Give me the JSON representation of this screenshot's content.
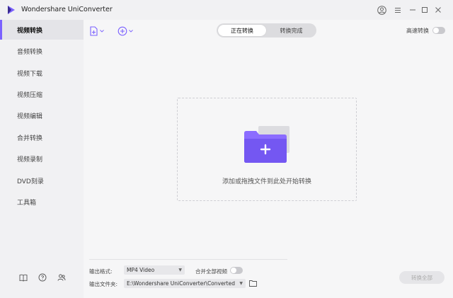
{
  "app": {
    "title": "Wondershare UniConverter",
    "accent_color": "#7b61ff"
  },
  "window_controls": [
    "account-icon",
    "menu-icon",
    "minimize-icon",
    "maximize-icon",
    "close-icon"
  ],
  "sidebar": {
    "items": [
      {
        "label": "视频转换",
        "active": true
      },
      {
        "label": "音频转换",
        "active": false
      },
      {
        "label": "视频下载",
        "active": false
      },
      {
        "label": "视频压缩",
        "active": false
      },
      {
        "label": "视频编辑",
        "active": false
      },
      {
        "label": "合并转换",
        "active": false
      },
      {
        "label": "视频录制",
        "active": false
      },
      {
        "label": "DVD刻录",
        "active": false
      },
      {
        "label": "工具箱",
        "active": false
      }
    ],
    "bottom_icons": [
      "book-icon",
      "help-icon",
      "community-icon"
    ]
  },
  "toolbar": {
    "add_file_icon": "add-file-icon",
    "add_media_icon": "add-media-icon",
    "tabs": [
      {
        "label": "正在转换",
        "active": true
      },
      {
        "label": "转换完成",
        "active": false
      }
    ],
    "high_speed_label": "高速转换",
    "high_speed_on": false
  },
  "dropzone": {
    "text": "添加或拖拽文件到此处开始转换",
    "icon": "folder-add-icon"
  },
  "footer": {
    "output_format_label": "输出格式:",
    "output_format_value": "MP4 Video",
    "merge_label": "合并全部视频",
    "merge_on": false,
    "output_folder_label": "输出文件夹:",
    "output_folder_value": "E:\\Wondershare UniConverter\\Converted",
    "start_all_label": "转换全部"
  }
}
